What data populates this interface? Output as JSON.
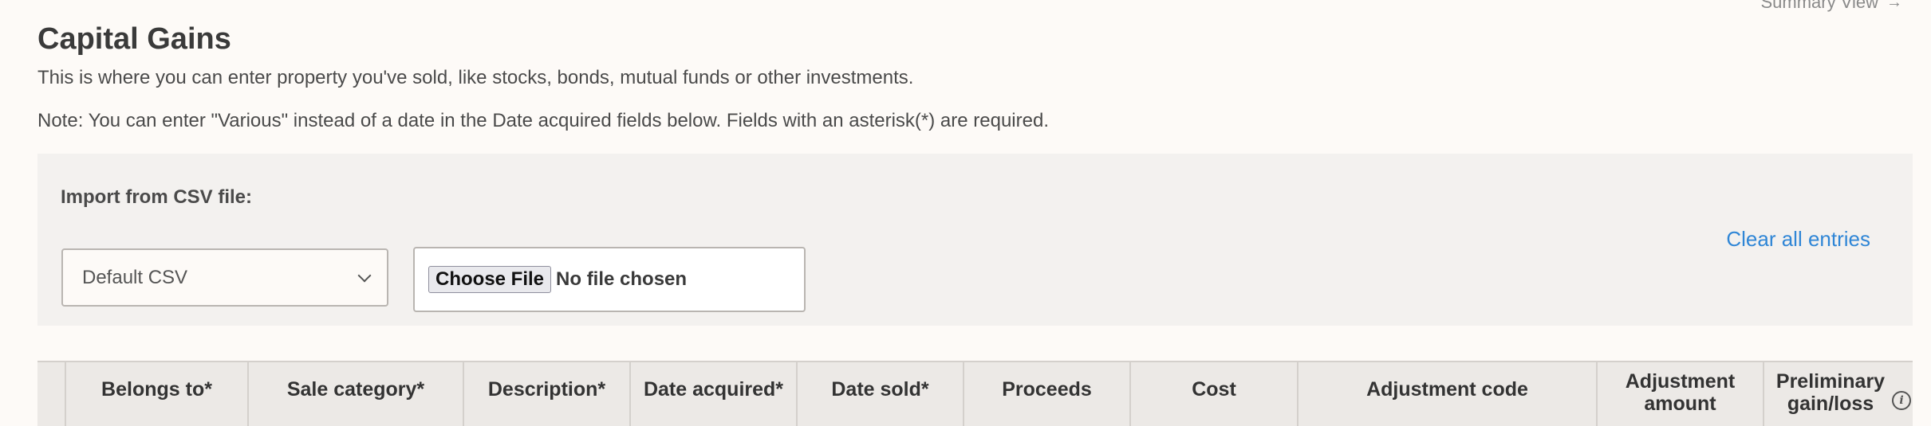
{
  "header": {
    "summary_link": "Summary View",
    "summary_arrow": "→",
    "title": "Capital Gains",
    "intro": "This is where you can enter property you've sold, like stocks, bonds, mutual funds or other investments.",
    "note": "Note: You can enter \"Various\" instead of a date in the Date acquired fields below. Fields with an asterisk(*) are required."
  },
  "import": {
    "label": "Import from CSV file:",
    "format_select": "Default CSV",
    "choose_file_button": "Choose File",
    "file_status": "No file chosen",
    "clear_all": "Clear all entries"
  },
  "table": {
    "columns": [
      "",
      "Belongs to*",
      "Sale category*",
      "Description*",
      "Date acquired*",
      "Date sold*",
      "Proceeds",
      "Cost",
      "Adjustment code",
      "Adjustment amount",
      "Preliminary gain/loss"
    ],
    "info_icon": "i"
  },
  "colors": {
    "background": "#fdfaf7",
    "panel": "#f3f1ef",
    "header_row": "#ece9e6",
    "link": "#2f86d6"
  }
}
